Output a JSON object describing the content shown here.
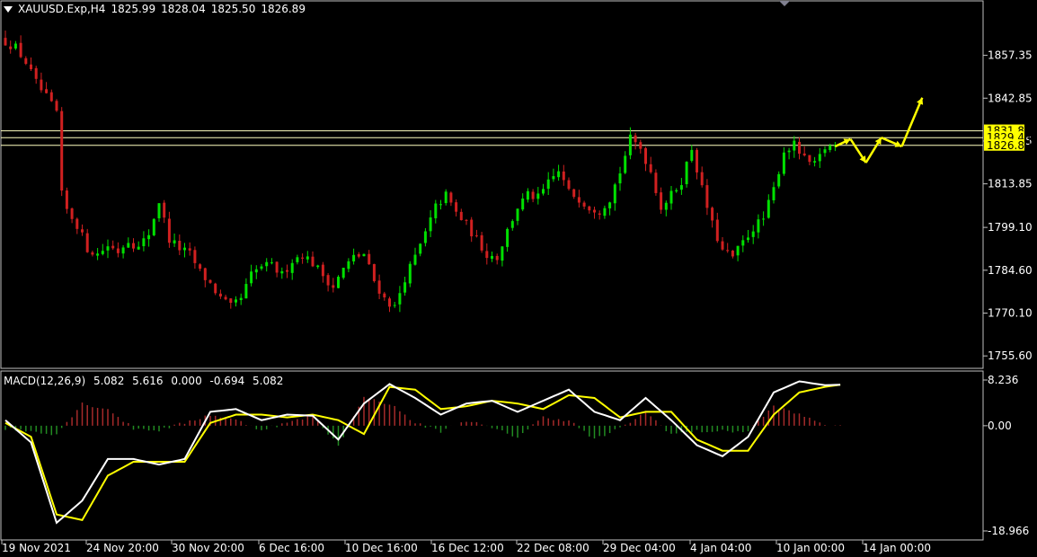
{
  "header": {
    "symbol": "XAUUSD.Exp,H4",
    "open": "1825.99",
    "high": "1828.04",
    "low": "1825.50",
    "close": "1826.89"
  },
  "macd_header": {
    "name": "MACD(12,26,9)",
    "v1": "5.082",
    "v2": "5.616",
    "v3": "0.000",
    "v4": "-0.694",
    "v5": "5.082"
  },
  "colors": {
    "background": "#000000",
    "bull": "#00e000",
    "bear": "#d02020",
    "hist_pos": "#a52a2a",
    "hist_neg": "#228b22",
    "macd_line": "#ffffff",
    "signal_line": "#ffff00",
    "level_line": "#ffffc0",
    "arrow": "#ffff00",
    "price_tag_bg": "#ffff00",
    "frame": "#c0c0c0"
  },
  "price_levels": [
    "1831.81",
    "1829.48",
    "1826.89"
  ],
  "chart_data": [
    {
      "type": "candlestick",
      "title": "XAUUSD.Exp,H4",
      "y_ticks": [
        "1857.35",
        "1842.85",
        "1828.35",
        "1813.85",
        "1799.10",
        "1784.60",
        "1770.10",
        "1755.60"
      ],
      "ylim": [
        1752,
        1870
      ],
      "x_ticks": [
        "19 Nov 2021",
        "24 Nov 20:00",
        "30 Nov 20:00",
        "6 Dec 16:00",
        "10 Dec 16:00",
        "16 Dec 12:00",
        "22 Dec 08:00",
        "29 Dec 04:00",
        "4 Jan 04:00",
        "10 Jan 00:00",
        "14 Jan 00:00"
      ],
      "horizontal_lines": [
        1831.81,
        1829.48,
        1826.89
      ],
      "close_path": [
        [
          0,
          1862
        ],
        [
          2,
          1860
        ],
        [
          4,
          1855
        ],
        [
          6,
          1848
        ],
        [
          8,
          1843
        ],
        [
          10,
          1838
        ],
        [
          11,
          1810
        ],
        [
          12,
          1805
        ],
        [
          14,
          1800
        ],
        [
          16,
          1792
        ],
        [
          18,
          1790
        ],
        [
          20,
          1793
        ],
        [
          22,
          1791
        ],
        [
          24,
          1795
        ],
        [
          26,
          1792
        ],
        [
          28,
          1797
        ],
        [
          30,
          1808
        ],
        [
          32,
          1795
        ],
        [
          34,
          1792
        ],
        [
          36,
          1790
        ],
        [
          38,
          1784
        ],
        [
          40,
          1780
        ],
        [
          42,
          1775
        ],
        [
          44,
          1772
        ],
        [
          46,
          1775
        ],
        [
          48,
          1783
        ],
        [
          50,
          1786
        ],
        [
          52,
          1786
        ],
        [
          54,
          1783
        ],
        [
          56,
          1788
        ],
        [
          58,
          1790
        ],
        [
          60,
          1787
        ],
        [
          62,
          1783
        ],
        [
          64,
          1779
        ],
        [
          66,
          1785
        ],
        [
          68,
          1789
        ],
        [
          70,
          1790
        ],
        [
          72,
          1781
        ],
        [
          74,
          1775
        ],
        [
          76,
          1772
        ],
        [
          78,
          1782
        ],
        [
          80,
          1789
        ],
        [
          82,
          1797
        ],
        [
          84,
          1806
        ],
        [
          86,
          1810
        ],
        [
          88,
          1804
        ],
        [
          90,
          1800
        ],
        [
          92,
          1795
        ],
        [
          94,
          1790
        ],
        [
          96,
          1789
        ],
        [
          98,
          1798
        ],
        [
          100,
          1806
        ],
        [
          102,
          1810
        ],
        [
          104,
          1809
        ],
        [
          106,
          1814
        ],
        [
          108,
          1818
        ],
        [
          110,
          1811
        ],
        [
          112,
          1809
        ],
        [
          114,
          1806
        ],
        [
          116,
          1805
        ],
        [
          118,
          1809
        ],
        [
          120,
          1818
        ],
        [
          122,
          1829
        ],
        [
          124,
          1826
        ],
        [
          126,
          1818
        ],
        [
          128,
          1806
        ],
        [
          130,
          1810
        ],
        [
          132,
          1815
        ],
        [
          134,
          1826
        ],
        [
          136,
          1812
        ],
        [
          138,
          1800
        ],
        [
          140,
          1791
        ],
        [
          142,
          1789
        ],
        [
          144,
          1794
        ],
        [
          146,
          1799
        ],
        [
          148,
          1802
        ],
        [
          150,
          1812
        ],
        [
          152,
          1825
        ],
        [
          154,
          1827
        ],
        [
          156,
          1822
        ],
        [
          158,
          1820
        ],
        [
          160,
          1826
        ],
        [
          162,
          1827
        ]
      ],
      "forecast_arrow_path": [
        [
          162,
          1826.5
        ],
        [
          165,
          1829
        ],
        [
          168,
          1821
        ],
        [
          171,
          1829.5
        ],
        [
          175,
          1826.5
        ],
        [
          179,
          1843
        ]
      ]
    },
    {
      "type": "line",
      "title": "MACD(12,26,9)",
      "y_ticks": [
        "8.236",
        "0.00",
        "-18.966"
      ],
      "ylim": [
        -18.966,
        8.236
      ],
      "series": [
        {
          "name": "",
          "x": [
            0,
            5,
            10,
            15,
            20,
            25,
            30,
            35,
            40,
            45,
            50,
            55,
            60,
            65,
            70,
            75,
            80,
            85,
            90,
            95,
            100,
            105,
            110,
            115,
            120,
            125,
            130,
            135,
            140,
            145,
            150,
            155,
            160,
            163
          ],
          "values": [
            1,
            -3,
            -17.5,
            -13.5,
            -6,
            -6,
            -7,
            -6,
            2.5,
            3,
            1,
            2,
            1.8,
            -2.5,
            4,
            7.5,
            5,
            2,
            4,
            4.5,
            2.5,
            4.5,
            6.5,
            2.5,
            1,
            5,
            1,
            -3.5,
            -5.5,
            -2,
            6,
            8,
            7.3,
            7.4
          ]
        },
        {
          "name": "",
          "x": [
            0,
            5,
            10,
            15,
            20,
            25,
            30,
            35,
            40,
            45,
            50,
            55,
            60,
            65,
            70,
            75,
            80,
            85,
            90,
            95,
            100,
            105,
            110,
            115,
            120,
            125,
            130,
            135,
            140,
            145,
            150,
            155,
            160,
            163
          ],
          "values": [
            0.5,
            -2,
            -16,
            -17,
            -9,
            -6.5,
            -6.5,
            -6.5,
            0.5,
            2,
            2,
            1.5,
            2,
            1,
            -1.5,
            7,
            6.5,
            3,
            3.5,
            4.5,
            4,
            3,
            5.5,
            5,
            1.5,
            2.5,
            2.5,
            -2.5,
            -4.5,
            -4.5,
            2,
            6,
            7,
            7.4
          ]
        },
        {
          "name": "",
          "x": [
            0,
            5,
            10,
            15,
            20,
            25,
            30,
            35,
            40,
            45,
            50,
            55,
            60,
            65,
            70,
            75,
            80,
            85,
            90,
            95,
            100,
            105,
            110,
            115,
            120,
            125,
            130,
            135,
            140,
            145,
            150,
            155,
            160,
            163
          ],
          "values": [
            -0.5,
            -1,
            -1.5,
            4,
            3,
            -0.5,
            -0.8,
            0.5,
            2,
            1,
            -0.7,
            0.5,
            1.8,
            -3.5,
            5,
            4,
            0.5,
            -1,
            1,
            -0.5,
            -2,
            1.5,
            1,
            -2.5,
            -0.5,
            2.5,
            -1.5,
            -1,
            -1,
            -1,
            3.5,
            2,
            0.3,
            -0.2
          ]
        }
      ]
    }
  ]
}
